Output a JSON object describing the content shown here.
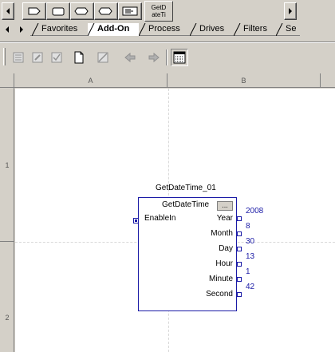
{
  "palette": {
    "get_datetime_button": [
      "GetD",
      "ateTi"
    ]
  },
  "tabs": [
    {
      "label": "Favorites",
      "active": false
    },
    {
      "label": "Add-On",
      "active": true
    },
    {
      "label": "Process",
      "active": false
    },
    {
      "label": "Drives",
      "active": false
    },
    {
      "label": "Filters",
      "active": false
    },
    {
      "label": "Se",
      "active": false
    }
  ],
  "ladder": {
    "columns": [
      "A",
      "B"
    ],
    "rows": [
      "1",
      "2"
    ]
  },
  "instruction": {
    "tag": "GetDateTime_01",
    "name": "GetDateTime",
    "ellipsis": "...",
    "input": "EnableIn",
    "outputs": [
      {
        "label": "Year",
        "value": "2008"
      },
      {
        "label": "Month",
        "value": "8"
      },
      {
        "label": "Day",
        "value": "30"
      },
      {
        "label": "Hour",
        "value": "13"
      },
      {
        "label": "Minute",
        "value": "1"
      },
      {
        "label": "Second",
        "value": "42"
      }
    ]
  },
  "colors": {
    "block_border": "#1a1aa6",
    "background": "#d4d0c8"
  }
}
